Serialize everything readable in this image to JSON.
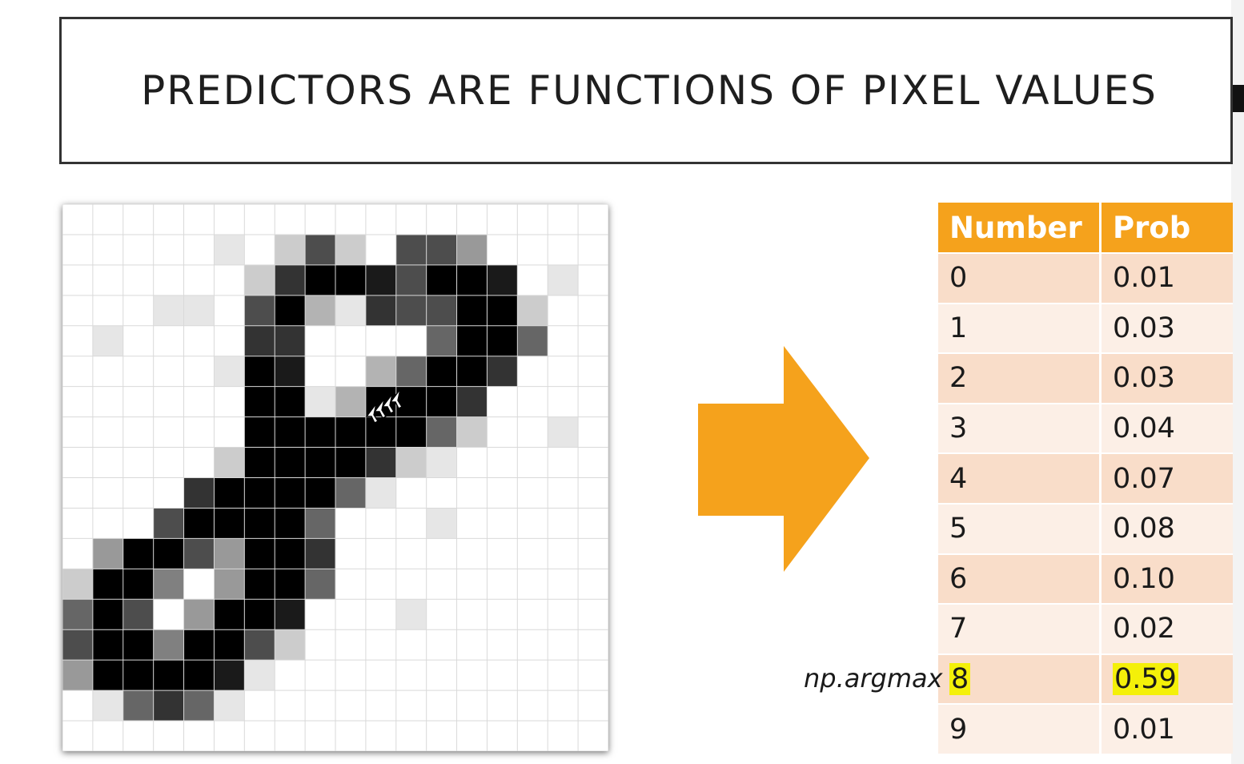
{
  "slide": {
    "title": "PREDICTORS ARE FUNCTIONS OF PIXEL VALUES",
    "accent_color": "#f5a21c",
    "highlight_color": "#f4f009"
  },
  "pixel_image": {
    "rows": 18,
    "cols": 18,
    "grid_color": "#d9d9d9",
    "intensity": [
      [
        0,
        0,
        0,
        0,
        0,
        0,
        0,
        0,
        0,
        0,
        0,
        0,
        0,
        0,
        0,
        0,
        0,
        0
      ],
      [
        0,
        0,
        0,
        0,
        0,
        1,
        0,
        2,
        7,
        2,
        0,
        7,
        7,
        4,
        0,
        0,
        0,
        0
      ],
      [
        0,
        0,
        0,
        0,
        0,
        0,
        2,
        8,
        10,
        10,
        9,
        7,
        10,
        10,
        9,
        0,
        1,
        0
      ],
      [
        0,
        0,
        0,
        1,
        1,
        0,
        7,
        10,
        3,
        1,
        8,
        7,
        7,
        10,
        10,
        2,
        0,
        0
      ],
      [
        0,
        1,
        0,
        0,
        0,
        0,
        8,
        8,
        0,
        0,
        0,
        0,
        6,
        10,
        10,
        6,
        0,
        0
      ],
      [
        0,
        0,
        0,
        0,
        0,
        1,
        10,
        9,
        0,
        0,
        3,
        6,
        10,
        10,
        8,
        0,
        0,
        0
      ],
      [
        0,
        0,
        0,
        0,
        0,
        0,
        10,
        10,
        1,
        3,
        10,
        10,
        10,
        8,
        0,
        0,
        0,
        0
      ],
      [
        0,
        0,
        0,
        0,
        0,
        0,
        10,
        10,
        10,
        10,
        10,
        10,
        6,
        2,
        0,
        0,
        1,
        0
      ],
      [
        0,
        0,
        0,
        0,
        0,
        2,
        10,
        10,
        10,
        10,
        8,
        2,
        1,
        0,
        0,
        0,
        0,
        0
      ],
      [
        0,
        0,
        0,
        0,
        8,
        10,
        10,
        10,
        10,
        6,
        1,
        0,
        0,
        0,
        0,
        0,
        0,
        0
      ],
      [
        0,
        0,
        0,
        7,
        10,
        10,
        10,
        10,
        6,
        0,
        0,
        0,
        1,
        0,
        0,
        0,
        0,
        0
      ],
      [
        0,
        4,
        10,
        10,
        7,
        4,
        10,
        10,
        8,
        0,
        0,
        0,
        0,
        0,
        0,
        0,
        0,
        0
      ],
      [
        2,
        10,
        10,
        5,
        0,
        4,
        10,
        10,
        6,
        0,
        0,
        0,
        0,
        0,
        0,
        0,
        0,
        0
      ],
      [
        6,
        10,
        7,
        0,
        4,
        10,
        10,
        9,
        0,
        0,
        0,
        1,
        0,
        0,
        0,
        0,
        0,
        0
      ],
      [
        7,
        10,
        10,
        5,
        10,
        10,
        7,
        2,
        0,
        0,
        0,
        0,
        0,
        0,
        0,
        0,
        0,
        0
      ],
      [
        4,
        10,
        10,
        10,
        10,
        9,
        1,
        0,
        0,
        0,
        0,
        0,
        0,
        0,
        0,
        0,
        0,
        0
      ],
      [
        0,
        1,
        6,
        8,
        6,
        1,
        0,
        0,
        0,
        0,
        0,
        0,
        0,
        0,
        0,
        0,
        0,
        0
      ],
      [
        0,
        0,
        0,
        0,
        0,
        0,
        0,
        0,
        0,
        0,
        0,
        0,
        0,
        0,
        0,
        0,
        0,
        0
      ]
    ]
  },
  "arrow": {
    "color": "#f5a21c"
  },
  "table": {
    "headers": {
      "number": "Number",
      "prob": "Prob"
    },
    "rows": [
      {
        "number": "0",
        "prob": "0.01"
      },
      {
        "number": "1",
        "prob": "0.03"
      },
      {
        "number": "2",
        "prob": "0.03"
      },
      {
        "number": "3",
        "prob": "0.04"
      },
      {
        "number": "4",
        "prob": "0.07"
      },
      {
        "number": "5",
        "prob": "0.08"
      },
      {
        "number": "6",
        "prob": "0.10"
      },
      {
        "number": "7",
        "prob": "0.02"
      },
      {
        "number": "8",
        "prob": "0.59",
        "highlighted": true
      },
      {
        "number": "9",
        "prob": "0.01"
      }
    ]
  },
  "argmax_label": "np.argmax",
  "cursor": {
    "icon": "arrow-cursor-icon"
  }
}
